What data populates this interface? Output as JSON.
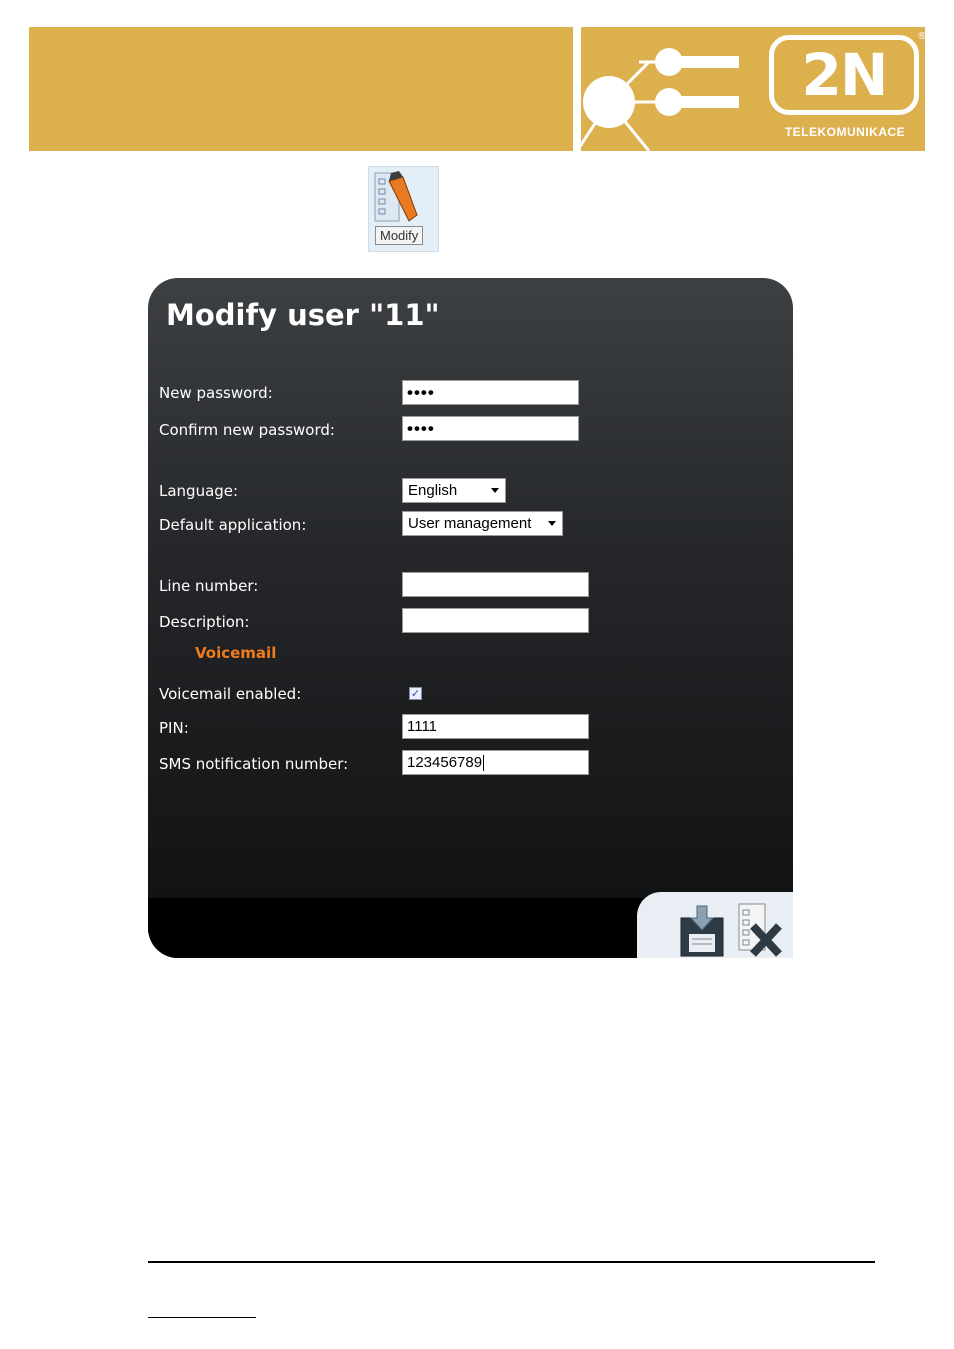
{
  "header": {
    "logo_text": "2N",
    "logo_subtitle": "TELEKOMUNIKACE",
    "logo_mark": "®",
    "accent_color": "#dbb04d"
  },
  "toolbar": {
    "modify_tooltip": "Modify",
    "modify_icon": "edit-pencil-icon"
  },
  "dialog": {
    "title": "Modify user \"11\"",
    "labels": {
      "new_password": "New password:",
      "confirm_password": "Confirm new password:",
      "language": "Language:",
      "default_application": "Default application:",
      "line_number": "Line number:",
      "description": "Description:",
      "voicemail_section": "Voicemail",
      "voicemail_enabled": "Voicemail enabled:",
      "pin": "PIN:",
      "sms_number": "SMS notification number:"
    },
    "values": {
      "new_password": "••••",
      "confirm_password": "••••",
      "language": "English",
      "default_application": "User management",
      "line_number": "",
      "description": "",
      "voicemail_enabled": true,
      "voicemail_check": "✓",
      "pin": "1111",
      "sms_number": "123456789"
    },
    "section_color": "#f07c1a",
    "actions": {
      "save_icon": "save-disk-icon",
      "cancel_icon": "cancel-x-icon"
    }
  }
}
